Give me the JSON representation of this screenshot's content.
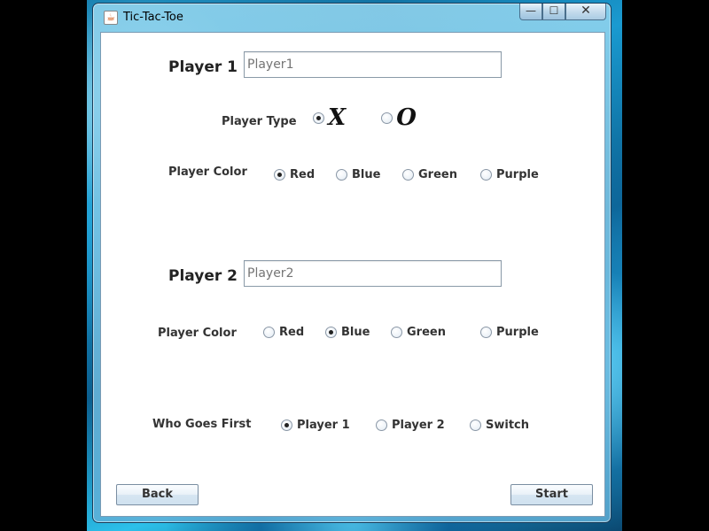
{
  "window": {
    "title": "Tic-Tac-Toe",
    "app_icon_glyph": "☕",
    "minimize_glyph": "—",
    "maximize_glyph": "☐",
    "close_glyph": "✕"
  },
  "player1": {
    "label": "Player 1",
    "name_placeholder": "Player1",
    "type_label": "Player Type",
    "type_options": [
      {
        "label": "X",
        "checked": true
      },
      {
        "label": "O",
        "checked": false
      }
    ],
    "color_label": "Player Color",
    "color_options": [
      {
        "label": "Red",
        "checked": true
      },
      {
        "label": "Blue",
        "checked": false
      },
      {
        "label": "Green",
        "checked": false
      },
      {
        "label": "Purple",
        "checked": false
      }
    ]
  },
  "player2": {
    "label": "Player 2",
    "name_placeholder": "Player2",
    "color_label": "Player Color",
    "color_options": [
      {
        "label": "Red",
        "checked": false
      },
      {
        "label": "Blue",
        "checked": true
      },
      {
        "label": "Green",
        "checked": false
      },
      {
        "label": "Purple",
        "checked": false
      }
    ]
  },
  "first": {
    "label": "Who Goes First",
    "options": [
      {
        "label": "Player 1",
        "checked": true
      },
      {
        "label": "Player 2",
        "checked": false
      },
      {
        "label": "Switch",
        "checked": false
      }
    ]
  },
  "buttons": {
    "back": "Back",
    "start": "Start"
  }
}
